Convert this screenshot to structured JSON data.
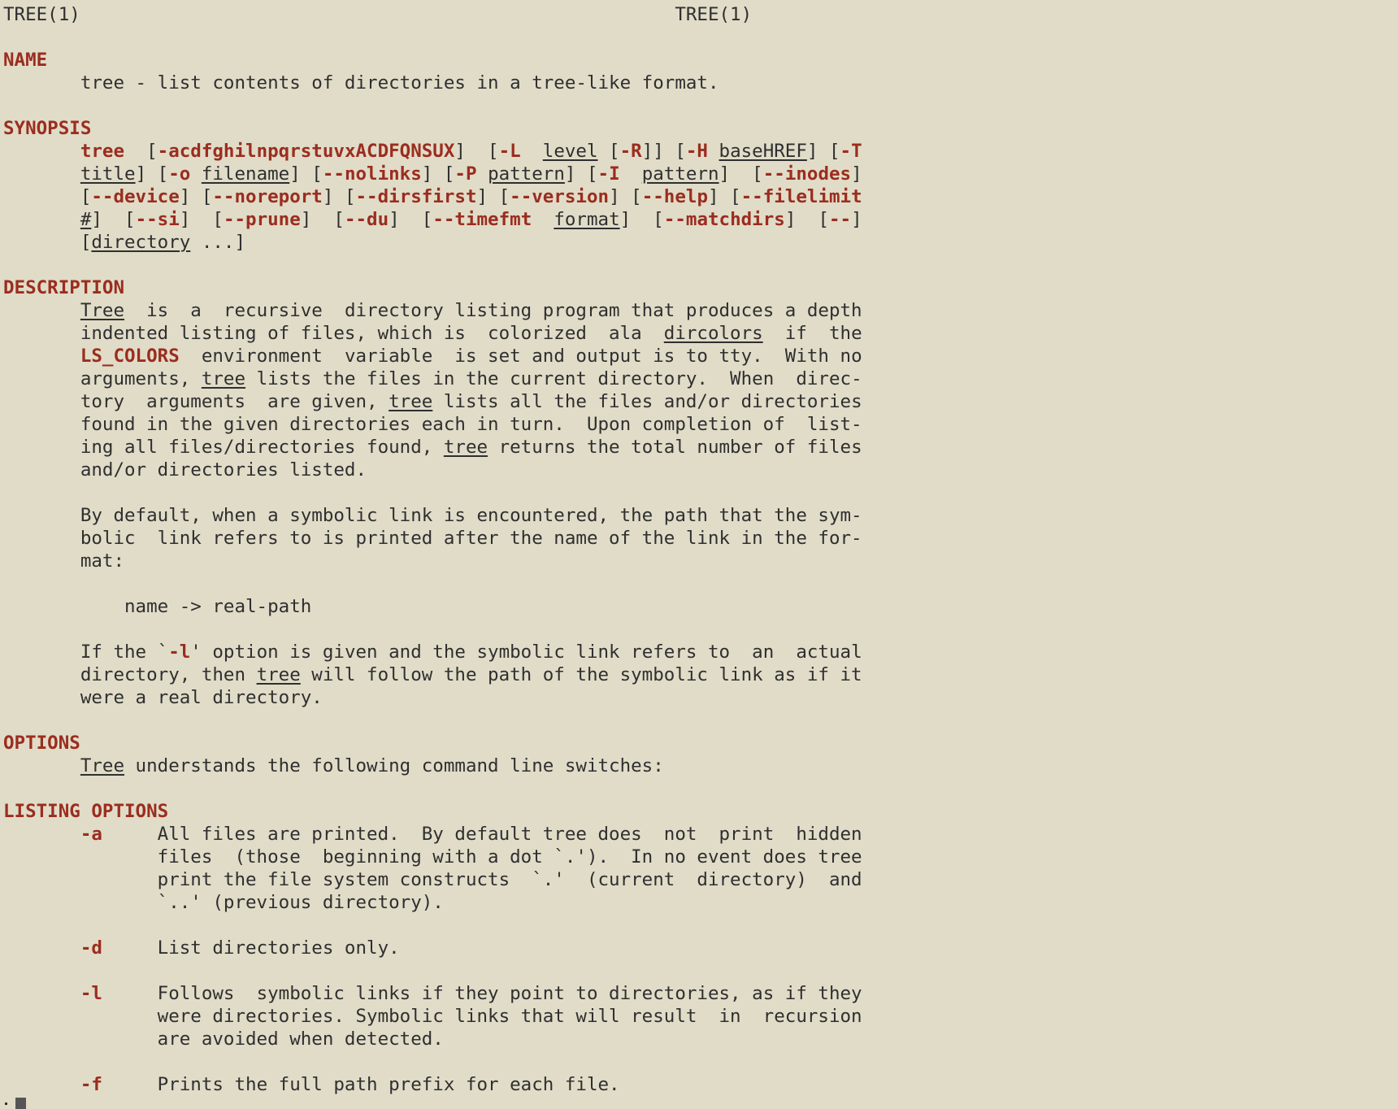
{
  "lines": [
    [
      {
        "t": "TREE(1)                                                      TREE(1)"
      }
    ],
    [
      {
        "t": ""
      }
    ],
    [
      {
        "t": "NAME",
        "s": "b"
      }
    ],
    [
      {
        "t": "       tree - list contents of directories in a tree-like format."
      }
    ],
    [
      {
        "t": ""
      }
    ],
    [
      {
        "t": "SYNOPSIS",
        "s": "b"
      }
    ],
    [
      {
        "t": "       "
      },
      {
        "t": "tree",
        "s": "b"
      },
      {
        "t": "  ["
      },
      {
        "t": "-acdfghilnpqrstuvxACDFQNSUX",
        "s": "b"
      },
      {
        "t": "]  ["
      },
      {
        "t": "-L",
        "s": "b"
      },
      {
        "t": "  "
      },
      {
        "t": "level",
        "s": "u"
      },
      {
        "t": " ["
      },
      {
        "t": "-R",
        "s": "b"
      },
      {
        "t": "]] ["
      },
      {
        "t": "-H",
        "s": "b"
      },
      {
        "t": " "
      },
      {
        "t": "baseHREF",
        "s": "u"
      },
      {
        "t": "] ["
      },
      {
        "t": "-T",
        "s": "b"
      }
    ],
    [
      {
        "t": "       "
      },
      {
        "t": "title",
        "s": "u"
      },
      {
        "t": "] ["
      },
      {
        "t": "-o",
        "s": "b"
      },
      {
        "t": " "
      },
      {
        "t": "filename",
        "s": "u"
      },
      {
        "t": "] ["
      },
      {
        "t": "--nolinks",
        "s": "b"
      },
      {
        "t": "] ["
      },
      {
        "t": "-P",
        "s": "b"
      },
      {
        "t": " "
      },
      {
        "t": "pattern",
        "s": "u"
      },
      {
        "t": "] ["
      },
      {
        "t": "-I",
        "s": "b"
      },
      {
        "t": "  "
      },
      {
        "t": "pattern",
        "s": "u"
      },
      {
        "t": "]  ["
      },
      {
        "t": "--inodes",
        "s": "b"
      },
      {
        "t": "]"
      }
    ],
    [
      {
        "t": "       ["
      },
      {
        "t": "--device",
        "s": "b"
      },
      {
        "t": "] ["
      },
      {
        "t": "--noreport",
        "s": "b"
      },
      {
        "t": "] ["
      },
      {
        "t": "--dirsfirst",
        "s": "b"
      },
      {
        "t": "] ["
      },
      {
        "t": "--version",
        "s": "b"
      },
      {
        "t": "] ["
      },
      {
        "t": "--help",
        "s": "b"
      },
      {
        "t": "] ["
      },
      {
        "t": "--filelimit",
        "s": "b"
      }
    ],
    [
      {
        "t": "       "
      },
      {
        "t": "#",
        "s": "u"
      },
      {
        "t": "]  ["
      },
      {
        "t": "--si",
        "s": "b"
      },
      {
        "t": "]  ["
      },
      {
        "t": "--prune",
        "s": "b"
      },
      {
        "t": "]  ["
      },
      {
        "t": "--du",
        "s": "b"
      },
      {
        "t": "]  ["
      },
      {
        "t": "--timefmt",
        "s": "b"
      },
      {
        "t": "  "
      },
      {
        "t": "format",
        "s": "u"
      },
      {
        "t": "]  ["
      },
      {
        "t": "--matchdirs",
        "s": "b"
      },
      {
        "t": "]  ["
      },
      {
        "t": "--",
        "s": "b"
      },
      {
        "t": "]"
      }
    ],
    [
      {
        "t": "       ["
      },
      {
        "t": "directory",
        "s": "u"
      },
      {
        "t": " ...]"
      }
    ],
    [
      {
        "t": ""
      }
    ],
    [
      {
        "t": "DESCRIPTION",
        "s": "b"
      }
    ],
    [
      {
        "t": "       "
      },
      {
        "t": "Tree",
        "s": "u"
      },
      {
        "t": "  is  a  recursive  directory listing program that produces a depth"
      }
    ],
    [
      {
        "t": "       indented listing of files, which is  colorized  ala  "
      },
      {
        "t": "dircolors",
        "s": "u"
      },
      {
        "t": "  if  the"
      }
    ],
    [
      {
        "t": "       "
      },
      {
        "t": "LS_COLORS",
        "s": "b"
      },
      {
        "t": "  environment  variable  is set and output is to tty.  With no"
      }
    ],
    [
      {
        "t": "       arguments, "
      },
      {
        "t": "tree",
        "s": "u"
      },
      {
        "t": " lists the files in the current directory.  When  direc-"
      }
    ],
    [
      {
        "t": "       tory  arguments  are given, "
      },
      {
        "t": "tree",
        "s": "u"
      },
      {
        "t": " lists all the files and/or directories"
      }
    ],
    [
      {
        "t": "       found in the given directories each in turn.  Upon completion of  list-"
      }
    ],
    [
      {
        "t": "       ing all files/directories found, "
      },
      {
        "t": "tree",
        "s": "u"
      },
      {
        "t": " returns the total number of files"
      }
    ],
    [
      {
        "t": "       and/or directories listed."
      }
    ],
    [
      {
        "t": ""
      }
    ],
    [
      {
        "t": "       By default, when a symbolic link is encountered, the path that the sym-"
      }
    ],
    [
      {
        "t": "       bolic  link refers to is printed after the name of the link in the for-"
      }
    ],
    [
      {
        "t": "       mat:"
      }
    ],
    [
      {
        "t": ""
      }
    ],
    [
      {
        "t": "           name -> real-path"
      }
    ],
    [
      {
        "t": ""
      }
    ],
    [
      {
        "t": "       If the `"
      },
      {
        "t": "-l",
        "s": "b"
      },
      {
        "t": "' option is given and the symbolic link refers to  an  actual"
      }
    ],
    [
      {
        "t": "       directory, then "
      },
      {
        "t": "tree",
        "s": "u"
      },
      {
        "t": " will follow the path of the symbolic link as if it"
      }
    ],
    [
      {
        "t": "       were a real directory."
      }
    ],
    [
      {
        "t": ""
      }
    ],
    [
      {
        "t": "OPTIONS",
        "s": "b"
      }
    ],
    [
      {
        "t": "       "
      },
      {
        "t": "Tree",
        "s": "u"
      },
      {
        "t": " understands the following command line switches:"
      }
    ],
    [
      {
        "t": ""
      }
    ],
    [
      {
        "t": "LISTING OPTIONS",
        "s": "b"
      }
    ],
    [
      {
        "t": "       "
      },
      {
        "t": "-a",
        "s": "b"
      },
      {
        "t": "     All files are printed.  By default tree does  not  print  hidden"
      }
    ],
    [
      {
        "t": "              files  (those  beginning with a dot `.').  In no event does tree"
      }
    ],
    [
      {
        "t": "              print the file system constructs  `.'  (current  directory)  and"
      }
    ],
    [
      {
        "t": "              `..' (previous directory)."
      }
    ],
    [
      {
        "t": ""
      }
    ],
    [
      {
        "t": "       "
      },
      {
        "t": "-d",
        "s": "b"
      },
      {
        "t": "     List directories only."
      }
    ],
    [
      {
        "t": ""
      }
    ],
    [
      {
        "t": "       "
      },
      {
        "t": "-l",
        "s": "b"
      },
      {
        "t": "     Follows  symbolic links if they point to directories, as if they"
      }
    ],
    [
      {
        "t": "              were directories. Symbolic links that will result  in  recursion"
      }
    ],
    [
      {
        "t": "              are avoided when detected."
      }
    ],
    [
      {
        "t": ""
      }
    ],
    [
      {
        "t": "       "
      },
      {
        "t": "-f",
        "s": "b"
      },
      {
        "t": "     Prints the full path prefix for each file."
      }
    ]
  ],
  "colors": {
    "background": "#e0dcc8",
    "text": "#2f2f2f",
    "bold": "#9b2d1f"
  }
}
